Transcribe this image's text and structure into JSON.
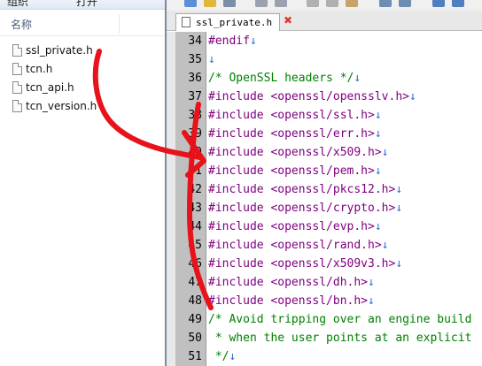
{
  "explorer": {
    "toolbar": [
      "组织",
      "打开"
    ],
    "column_header": "名称",
    "files": [
      "ssl_private.h",
      "tcn.h",
      "tcn_api.h",
      "tcn_version.h"
    ]
  },
  "editor": {
    "tab_label": "ssl_private.h",
    "close_glyph": "✖",
    "return_glyph": "↓",
    "lines": [
      {
        "n": "34",
        "text": "#endif",
        "kind": "k"
      },
      {
        "n": "35",
        "text": "",
        "kind": "p"
      },
      {
        "n": "36",
        "text": "/* OpenSSL headers */",
        "kind": "c"
      },
      {
        "n": "37",
        "text": "#include <openssl/opensslv.h>",
        "kind": "k"
      },
      {
        "n": "38",
        "text": "#include <openssl/ssl.h>",
        "kind": "k"
      },
      {
        "n": "39",
        "text": "#include <openssl/err.h>",
        "kind": "k"
      },
      {
        "n": "40",
        "text": "#include <openssl/x509.h>",
        "kind": "k"
      },
      {
        "n": "41",
        "text": "#include <openssl/pem.h>",
        "kind": "k"
      },
      {
        "n": "42",
        "text": "#include <openssl/pkcs12.h>",
        "kind": "k"
      },
      {
        "n": "43",
        "text": "#include <openssl/crypto.h>",
        "kind": "k"
      },
      {
        "n": "44",
        "text": "#include <openssl/evp.h>",
        "kind": "k"
      },
      {
        "n": "45",
        "text": "#include <openssl/rand.h>",
        "kind": "k"
      },
      {
        "n": "46",
        "text": "#include <openssl/x509v3.h>",
        "kind": "k"
      },
      {
        "n": "47",
        "text": "#include <openssl/dh.h>",
        "kind": "k"
      },
      {
        "n": "48",
        "text": "#include <openssl/bn.h>",
        "kind": "k"
      },
      {
        "n": "49",
        "text": "/* Avoid tripping over an engine build",
        "kind": "c",
        "noret": true
      },
      {
        "n": "50",
        "text": " * when the user points at an explicit",
        "kind": "c",
        "noret": true
      },
      {
        "n": "51",
        "text": " */",
        "kind": "c"
      }
    ]
  },
  "annotation": {
    "color": "#e8121a"
  }
}
